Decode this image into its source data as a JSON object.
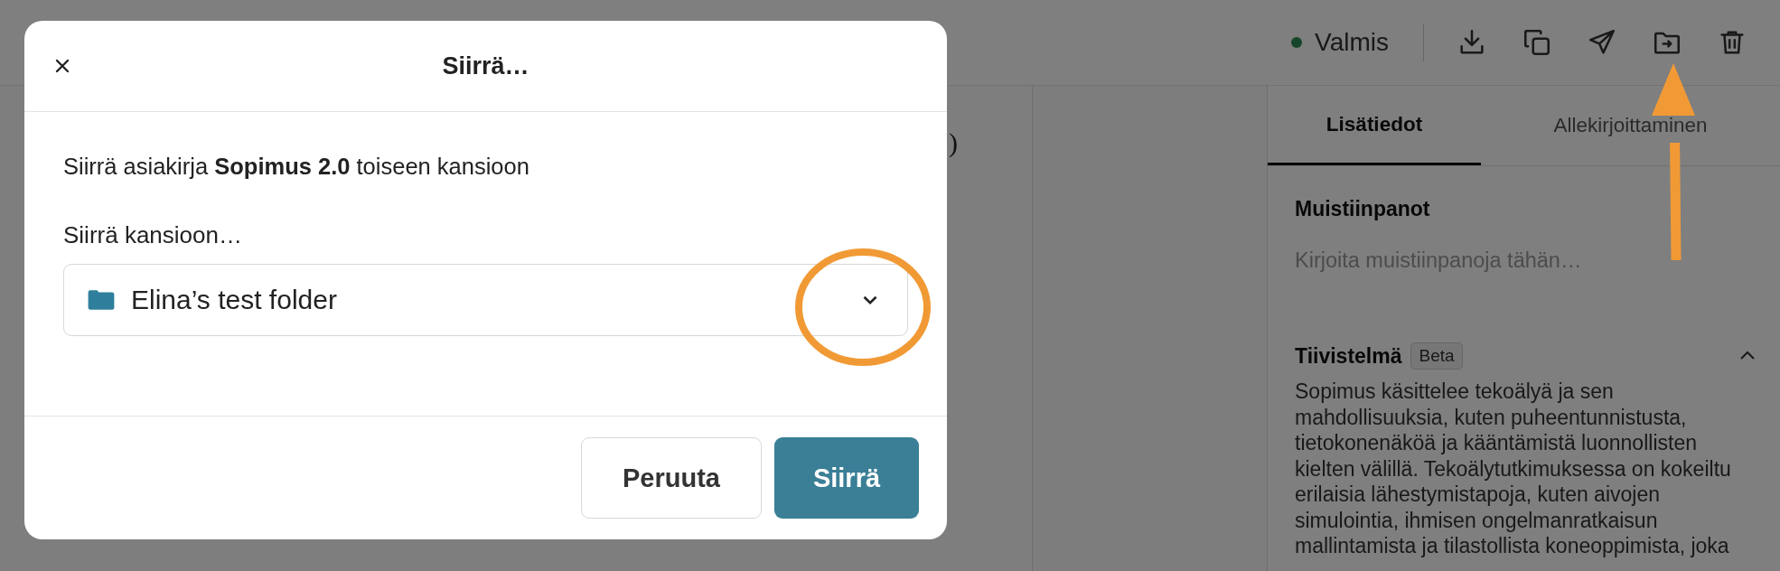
{
  "header": {
    "status": "Valmis",
    "actions": [
      {
        "kind": "download"
      },
      {
        "kind": "copy"
      },
      {
        "kind": "send"
      },
      {
        "kind": "move"
      },
      {
        "kind": "delete"
      }
    ]
  },
  "document": {
    "fragment": ")"
  },
  "sidebar": {
    "tabs": [
      {
        "label": "Lisätiedot",
        "selected": true
      },
      {
        "label": "Allekirjoittaminen",
        "selected": false
      }
    ],
    "notes": {
      "title": "Muistiinpanot",
      "placeholder": "Kirjoita muistiinpanoja tähän…"
    },
    "summary": {
      "title": "Tiivistelmä",
      "badge": "Beta",
      "expanded": true,
      "text": "Sopimus käsittelee tekoälyä ja sen mahdollisuuksia, kuten puheentunnistusta, tietokonenäköä ja kääntämistä luonnollisten kielten välillä. Tekoälytutkimuksessa on kokeiltu erilaisia lähestymistapoja, kuten aivojen simulointia, ihmisen ongelmanratkaisun mallintamista ja tilastollista koneoppimista, joka"
    }
  },
  "dialog": {
    "title": "Siirrä…",
    "message": "Siirrä asiakirja **Sopimus 2.0** toiseen kansioon",
    "field_label": "Siirrä kansioon…",
    "folder_select": {
      "value": "Elina’s test folder"
    },
    "buttons": [
      {
        "label": "Peruuta",
        "kind": "secondary"
      },
      {
        "label": "Siirrä",
        "kind": "primary"
      }
    ]
  }
}
